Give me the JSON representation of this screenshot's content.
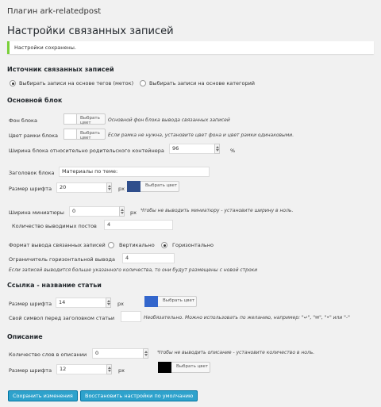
{
  "header": {
    "plugin_title": "Плагин ark-relatedpost",
    "page_title": "Настройки связанных записей",
    "notice": "Настройки сохранены."
  },
  "source": {
    "heading": "Источник связанных записей",
    "option_tags": "Выбирать записи на основе тегов (меток)",
    "option_categories": "Выбирать записи на основе категорий",
    "selected": "tags"
  },
  "main_block": {
    "heading": "Основной блок",
    "bg_label": "Фон блока",
    "bg_button": "Выбрать цвет",
    "bg_hint": "Основной фон блока вывода связанных записей",
    "border_label": "Цвет рамки блока",
    "border_button": "Выбрать цвет",
    "border_hint": "Если рамка не нужна, установите цвет фона и цвет рамки одинаковыми.",
    "width_label": "Ширина блока относительно родительского контейнера",
    "width_value": "96",
    "width_unit": "%",
    "title_label": "Заголовок блока",
    "title_value": "Материалы по теме:",
    "font_label": "Размер шрифта",
    "font_value": "20",
    "font_unit": "px",
    "font_button": "Выбрать цвет",
    "font_color": "#2f4e8c",
    "thumb_label": "Ширина миниатюры",
    "thumb_value": "0",
    "thumb_unit": "px",
    "thumb_hint": "Чтобы не выводить миниатюру - установите ширину в ноль.",
    "count_label": "Количество выводимых постов",
    "count_value": "4",
    "format_label": "Формат вывода связанных записей",
    "format_vertical": "Вертикально",
    "format_horizontal": "Горизонтально",
    "format_selected": "horizontal",
    "limiter_label": "Ограничитель горизонтальной выводa",
    "limiter_value": "4",
    "limiter_hint": "Если записей выводится больше указанного количества, то они будут размещены с новой строки"
  },
  "link": {
    "heading": "Ссылка - название статьи",
    "font_label": "Размер шрифта",
    "font_value": "14",
    "font_unit": "px",
    "font_button": "Выбрать цвет",
    "font_color": "#3366cc",
    "symbol_label": "Свой символ перед заголовком статьи",
    "symbol_value": "",
    "symbol_hint": "Необязательно. Можно использовать по желанию, например: \"↵\", \"✉\", \"•\" или \"-\""
  },
  "description": {
    "heading": "Описание",
    "words_label": "Количество слов в описании",
    "words_value": "0",
    "words_hint": "Чтобы не выводить описание - установите количество в ноль.",
    "font_label": "Размер шрифта",
    "font_value": "12",
    "font_unit": "px",
    "font_button": "Выбрать цвет",
    "font_color": "#000000"
  },
  "footer": {
    "save_button": "Сохранить изменения",
    "reset_button": "Восстановить настройки по умолчанию"
  }
}
